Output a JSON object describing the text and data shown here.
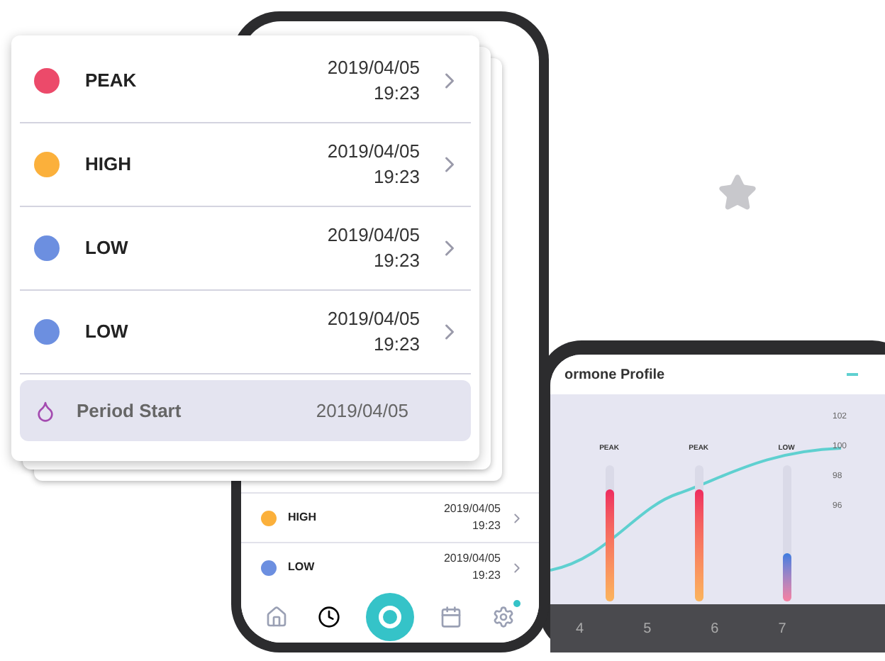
{
  "front_card": {
    "rows": [
      {
        "kind": "reading",
        "label": "PEAK",
        "date": "2019/04/05",
        "time": "19:23",
        "color": "#ec4a6a"
      },
      {
        "kind": "reading",
        "label": "HIGH",
        "date": "2019/04/05",
        "time": "19:23",
        "color": "#fbb03b"
      },
      {
        "kind": "reading",
        "label": "LOW",
        "date": "2019/04/05",
        "time": "19:23",
        "color": "#6c8fe0"
      },
      {
        "kind": "reading",
        "label": "LOW",
        "date": "2019/04/05",
        "time": "19:23",
        "color": "#6c8fe0"
      },
      {
        "kind": "event",
        "label": "Period Start",
        "date": "2019/04/05",
        "selected": true
      }
    ]
  },
  "phone_list": {
    "rows": [
      {
        "label": "HIGH",
        "date": "2019/04/05",
        "time": "19:23",
        "color": "#fbb03b"
      },
      {
        "label": "LOW",
        "date": "2019/04/05",
        "time": "19:23",
        "color": "#6c8fe0"
      }
    ]
  },
  "tab_bar": {
    "items": [
      {
        "kind": "home",
        "selected": false
      },
      {
        "kind": "clock",
        "selected": true
      },
      {
        "kind": "record",
        "selected": false
      },
      {
        "kind": "calendar",
        "selected": false
      },
      {
        "kind": "settings",
        "selected": false,
        "badge": true
      }
    ]
  },
  "chart_panel": {
    "title": "ormone Profile",
    "bars": [
      {
        "label": "PEAK",
        "level": 0.82,
        "kind": "peak"
      },
      {
        "label": "PEAK",
        "level": 0.82,
        "kind": "peak"
      },
      {
        "label": "LOW",
        "level": 0.35,
        "kind": "low"
      }
    ],
    "y_ticks": [
      "102",
      "100",
      "98",
      "96"
    ],
    "x_labels": [
      "4",
      "5",
      "6",
      "7"
    ]
  }
}
